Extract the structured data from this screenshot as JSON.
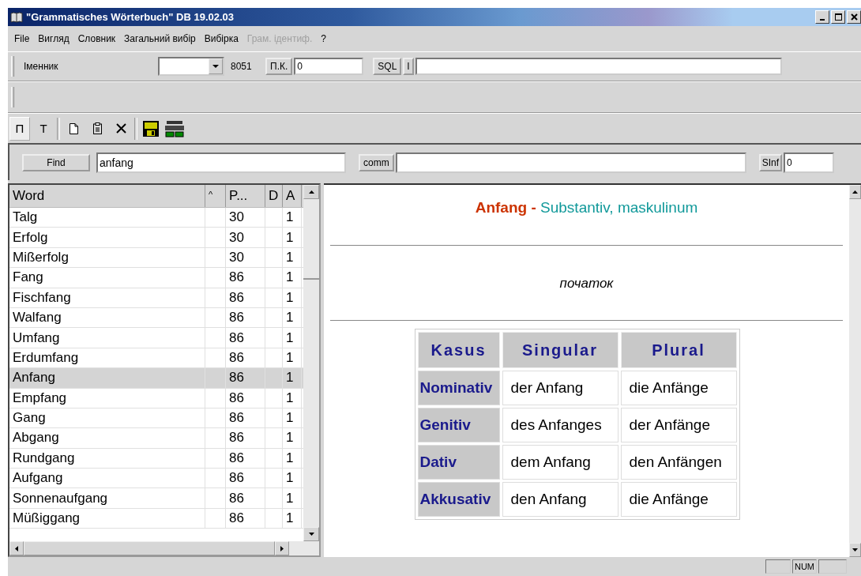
{
  "window": {
    "title": "\"Grammatisches Wörterbuch\" DB 19.02.03"
  },
  "menu": [
    {
      "label": "File",
      "disabled": false
    },
    {
      "label": "Вигляд",
      "disabled": false
    },
    {
      "label": "Словник",
      "disabled": false
    },
    {
      "label": "Загальний вибір",
      "disabled": false
    },
    {
      "label": "Вибірка",
      "disabled": false
    },
    {
      "label": "Грам. ідентиф.",
      "disabled": true
    },
    {
      "label": "?",
      "disabled": false
    }
  ],
  "toolbar": {
    "category": "Іменник",
    "count": "8051",
    "pk_button": "П.К.",
    "pk_value": "0",
    "sql_button": "SQL",
    "i_button": "I"
  },
  "tools": [
    {
      "kind": "letter",
      "label": "П",
      "selected": true
    },
    {
      "kind": "letter",
      "label": "Т",
      "selected": false
    },
    {
      "kind": "new"
    },
    {
      "kind": "paste"
    },
    {
      "kind": "delete"
    },
    {
      "kind": "save"
    },
    {
      "kind": "dict"
    }
  ],
  "find": {
    "button": "Find",
    "value": "anfang",
    "comm_button": "comm",
    "slnf_button": "SInf",
    "slnf_value": "0"
  },
  "list": {
    "columns": [
      "Word",
      "^",
      "P...",
      "D",
      "A"
    ],
    "rows": [
      {
        "word": "Talg",
        "p": "30",
        "a": "1",
        "selected": false
      },
      {
        "word": "Erfolg",
        "p": "30",
        "a": "1",
        "selected": false
      },
      {
        "word": "Mißerfolg",
        "p": "30",
        "a": "1",
        "selected": false
      },
      {
        "word": "Fang",
        "p": "86",
        "a": "1",
        "selected": false
      },
      {
        "word": "Fischfang",
        "p": "86",
        "a": "1",
        "selected": false
      },
      {
        "word": "Walfang",
        "p": "86",
        "a": "1",
        "selected": false
      },
      {
        "word": "Umfang",
        "p": "86",
        "a": "1",
        "selected": false
      },
      {
        "word": "Erdumfang",
        "p": "86",
        "a": "1",
        "selected": false
      },
      {
        "word": "Anfang",
        "p": "86",
        "a": "1",
        "selected": true
      },
      {
        "word": "Empfang",
        "p": "86",
        "a": "1",
        "selected": false
      },
      {
        "word": "Gang",
        "p": "86",
        "a": "1",
        "selected": false
      },
      {
        "word": "Abgang",
        "p": "86",
        "a": "1",
        "selected": false
      },
      {
        "word": "Rundgang",
        "p": "86",
        "a": "1",
        "selected": false
      },
      {
        "word": "Aufgang",
        "p": "86",
        "a": "1",
        "selected": false
      },
      {
        "word": "Sonnenaufgang",
        "p": "86",
        "a": "1",
        "selected": false
      },
      {
        "word": "Müßiggang",
        "p": "86",
        "a": "1",
        "selected": false
      }
    ]
  },
  "entry": {
    "headword": "Anfang",
    "separator": "-",
    "grammar": "Substantiv, maskulinum",
    "translation": "початок",
    "table": {
      "columns": [
        "Kasus",
        "Singular",
        "Plural"
      ],
      "rows": [
        {
          "case": "Nominativ",
          "singular": "der Anfang",
          "plural": "die Anfänge"
        },
        {
          "case": "Genitiv",
          "singular": "des Anfanges",
          "plural": "der Anfänge"
        },
        {
          "case": "Dativ",
          "singular": "dem Anfang",
          "plural": "den Anfängen"
        },
        {
          "case": "Akkusativ",
          "singular": "den Anfang",
          "plural": "die Anfänge"
        }
      ]
    }
  },
  "status_bar": {
    "num": "NUM"
  }
}
